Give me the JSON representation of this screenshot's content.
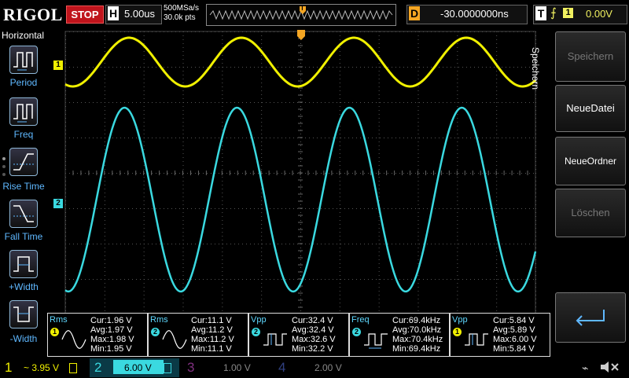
{
  "topbar": {
    "logo": "RIGOL",
    "run_state": "STOP",
    "horizontal_letter": "H",
    "timebase": "5.00us",
    "sample_rate": "500MSa/s",
    "memory_depth": "30.0k pts",
    "trigger_marker": "T",
    "delay_letter": "D",
    "delay_value": "-30.0000000ns",
    "trigger_letter": "T",
    "trigger_edge": "⨍",
    "trigger_source": "1",
    "trigger_level": "0.00V"
  },
  "left_menu": {
    "title": "Horizontal",
    "items": [
      {
        "label": "Period"
      },
      {
        "label": "Freq"
      },
      {
        "label": "Rise Time"
      },
      {
        "label": "Fall Time"
      },
      {
        "label": "+Width"
      },
      {
        "label": "-Width"
      }
    ]
  },
  "right_menu": {
    "title": "Speichern",
    "items": [
      {
        "label": "Speichern"
      },
      {
        "label": "NeueDatei"
      },
      {
        "label": "NeueOrdner"
      },
      {
        "label": "Löschen"
      },
      {
        "label": "↵"
      }
    ]
  },
  "channel_markers": {
    "ch1": "1",
    "ch2": "2"
  },
  "measurements": [
    {
      "name": "Rms",
      "channel": "1",
      "color": "#f0f000",
      "cur": "Cur:1.96 V",
      "avg": "Avg:1.97 V",
      "max": "Max:1.98 V",
      "min": "Min:1.95 V"
    },
    {
      "name": "Rms",
      "channel": "2",
      "color": "#3ad9e0",
      "cur": "Cur:11.1 V",
      "avg": "Avg:11.2 V",
      "max": "Max:11.2 V",
      "min": "Min:11.1 V"
    },
    {
      "name": "Vpp",
      "channel": "2",
      "color": "#3ad9e0",
      "cur": "Cur:32.4 V",
      "avg": "Avg:32.4 V",
      "max": "Max:32.6 V",
      "min": "Min:32.2 V"
    },
    {
      "name": "Freq",
      "channel": "2",
      "color": "#3ad9e0",
      "cur": "Cur:69.4kHz",
      "avg": "Avg:70.0kHz",
      "max": "Max:70.4kHz",
      "min": "Min:69.4kHz"
    },
    {
      "name": "Vpp",
      "channel": "1",
      "color": "#f0f000",
      "cur": "Cur:5.84 V",
      "avg": "Avg:5.89 V",
      "max": "Max:6.00 V",
      "min": "Min:5.84 V"
    }
  ],
  "channels": [
    {
      "num": "1",
      "scale": "~ 3.95 V",
      "color": "#f0f000"
    },
    {
      "num": "2",
      "scale": "6.00 V",
      "color": "#3ad9e0"
    },
    {
      "num": "3",
      "scale": "1.00 V",
      "color": "#d050d0"
    },
    {
      "num": "4",
      "scale": "2.00 V",
      "color": "#4070ff"
    }
  ],
  "colors": {
    "ch1": "#f0f000",
    "ch2": "#3ad9e0",
    "trigger": "#f5a623",
    "stop": "#c0141c"
  }
}
